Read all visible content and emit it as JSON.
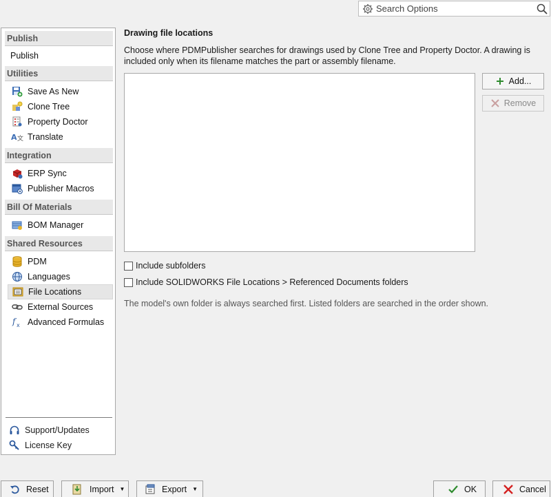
{
  "search": {
    "placeholder": "Search Options"
  },
  "sidebar": {
    "sections": [
      {
        "header": "Publish",
        "items": [
          {
            "label": "Publish",
            "icon": "none"
          }
        ]
      },
      {
        "header": "Utilities",
        "items": [
          {
            "label": "Save As New",
            "icon": "save-as-new-icon"
          },
          {
            "label": "Clone Tree",
            "icon": "clone-tree-icon"
          },
          {
            "label": "Property Doctor",
            "icon": "property-doctor-icon"
          },
          {
            "label": "Translate",
            "icon": "translate-icon"
          }
        ]
      },
      {
        "header": "Integration",
        "items": [
          {
            "label": "ERP Sync",
            "icon": "erp-sync-icon"
          },
          {
            "label": "Publisher Macros",
            "icon": "publisher-macros-icon"
          }
        ]
      },
      {
        "header": "Bill Of Materials",
        "items": [
          {
            "label": "BOM Manager",
            "icon": "bom-manager-icon"
          }
        ]
      },
      {
        "header": "Shared Resources",
        "items": [
          {
            "label": "PDM",
            "icon": "pdm-database-icon"
          },
          {
            "label": "Languages",
            "icon": "globe-icon"
          },
          {
            "label": "File Locations",
            "icon": "folder-locations-icon",
            "selected": true
          },
          {
            "label": "External Sources",
            "icon": "link-icon"
          },
          {
            "label": "Advanced Formulas",
            "icon": "fx-icon"
          }
        ]
      }
    ],
    "footer": [
      {
        "label": "Support/Updates",
        "icon": "headset-icon"
      },
      {
        "label": "License Key",
        "icon": "key-icon"
      }
    ]
  },
  "content": {
    "title": "Drawing file locations",
    "description": "Choose where PDMPublisher searches for drawings used by Clone Tree and Property Doctor. A drawing is included only when its filename matches the part or assembly filename.",
    "add_label": "Add...",
    "remove_label": "Remove",
    "folders": [],
    "include_subfolders_label": "Include subfolders",
    "include_subfolders_checked": false,
    "include_refdocs_label": "Include SOLIDWORKS File Locations > Referenced Documents folders",
    "include_refdocs_checked": false,
    "note": "The model's own folder is always searched first. Listed folders are searched in the order shown."
  },
  "bottom": {
    "reset_label": "Reset",
    "import_label": "Import",
    "export_label": "Export",
    "ok_label": "OK",
    "cancel_label": "Cancel"
  },
  "colors": {
    "accent_green": "#2e8b2e",
    "cancel_red": "#d42020",
    "selected_bg": "#e6e6e6"
  }
}
